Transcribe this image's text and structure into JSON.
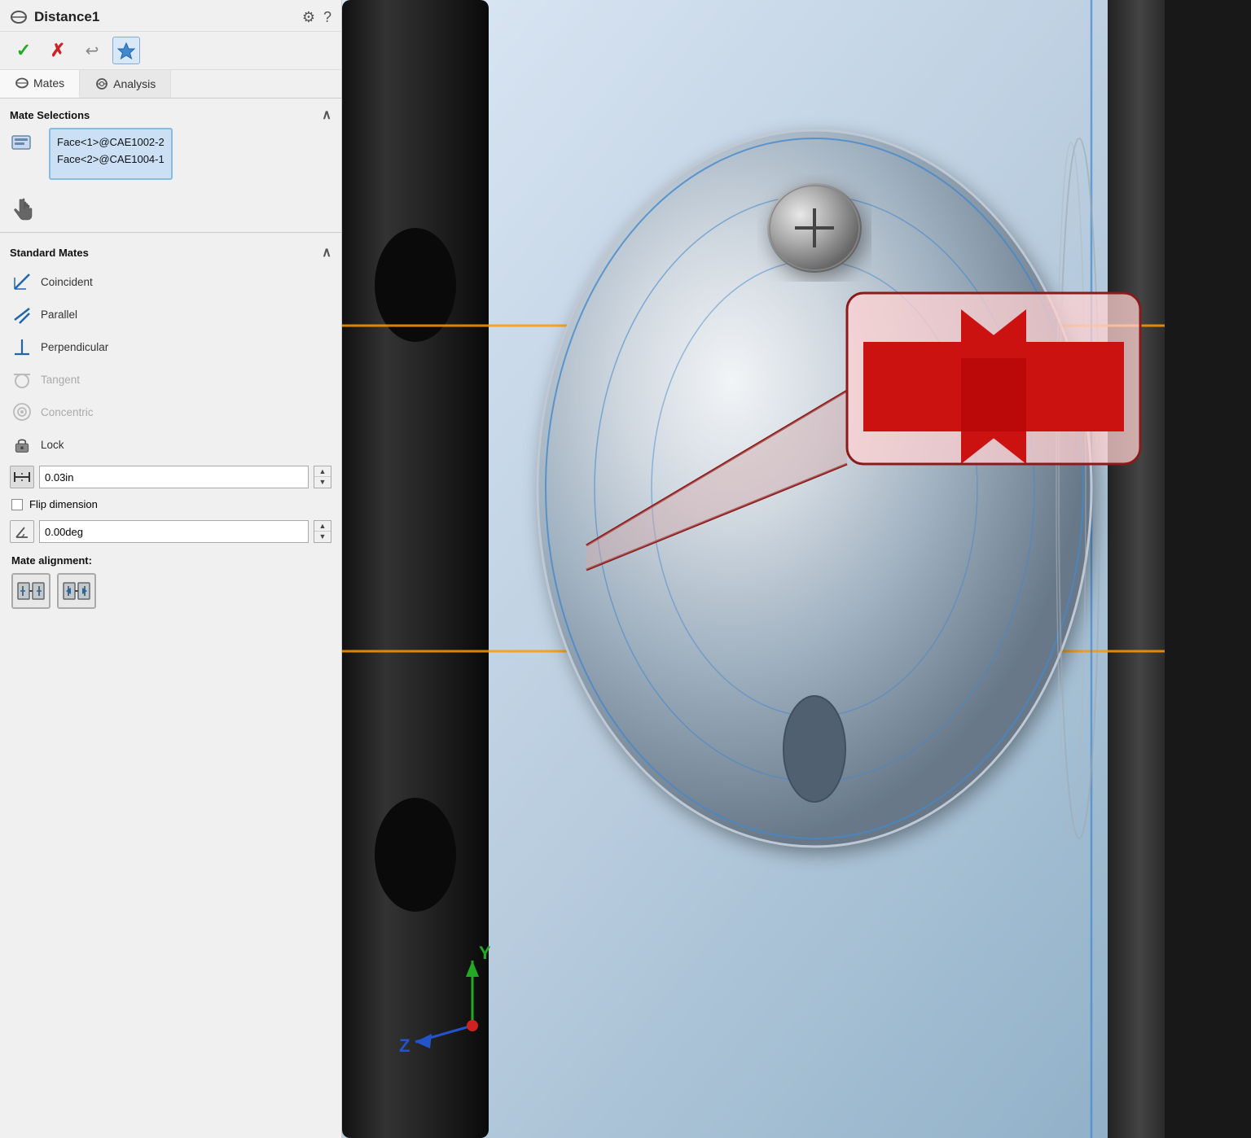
{
  "title": "Distance1",
  "toolbar": {
    "confirm_label": "✓",
    "cancel_label": "✗",
    "undo_label": "↩",
    "pin_label": "★"
  },
  "tabs": [
    {
      "id": "mates",
      "label": "Mates",
      "active": true
    },
    {
      "id": "analysis",
      "label": "Analysis",
      "active": false
    }
  ],
  "mate_selections": {
    "header": "Mate Selections",
    "face1": "Face<1>@CAE1002-2",
    "face2": "Face<2>@CAE1004-1"
  },
  "standard_mates": {
    "header": "Standard Mates",
    "items": [
      {
        "id": "coincident",
        "label": "Coincident"
      },
      {
        "id": "parallel",
        "label": "Parallel"
      },
      {
        "id": "perpendicular",
        "label": "Perpendicular"
      },
      {
        "id": "tangent",
        "label": "Tangent",
        "disabled": true
      },
      {
        "id": "concentric",
        "label": "Concentric",
        "disabled": true
      },
      {
        "id": "lock",
        "label": "Lock"
      }
    ]
  },
  "distance": {
    "value": "0.03in",
    "placeholder": "0.03in"
  },
  "flip_dimension": {
    "label": "Flip dimension",
    "checked": false
  },
  "angle": {
    "value": "0.00deg",
    "placeholder": "0.00deg"
  },
  "mate_alignment": {
    "label": "Mate alignment:"
  },
  "help_icons": [
    "?",
    "?"
  ]
}
